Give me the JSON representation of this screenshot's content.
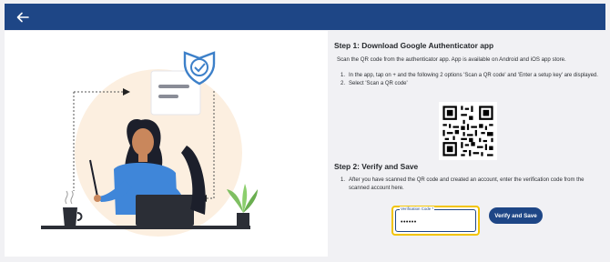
{
  "header": {
    "back_icon": "arrow-left-icon"
  },
  "step1": {
    "title": "Step 1: Download Google Authenticator app",
    "description": "Scan the QR code from the authenticator app. App is available on Android and iOS app store.",
    "items": [
      {
        "num": "1.",
        "text": "In the app, tap on + and the following 2 options 'Scan a QR code' and 'Enter a setup key' are displayed."
      },
      {
        "num": "2.",
        "text": "Select 'Scan a QR code'"
      }
    ]
  },
  "step2": {
    "title": "Step 2: Verify and Save",
    "items": [
      {
        "num": "1.",
        "text": "After you have scanned the QR code and created an account, enter the verification code from the scanned account here."
      }
    ]
  },
  "verification": {
    "label": "Verification Code *",
    "value": "••••••"
  },
  "verify_button": {
    "label": "Verify and Save"
  },
  "colors": {
    "header": "#1e4686",
    "accent": "#f2c400",
    "button": "#1e4686"
  }
}
